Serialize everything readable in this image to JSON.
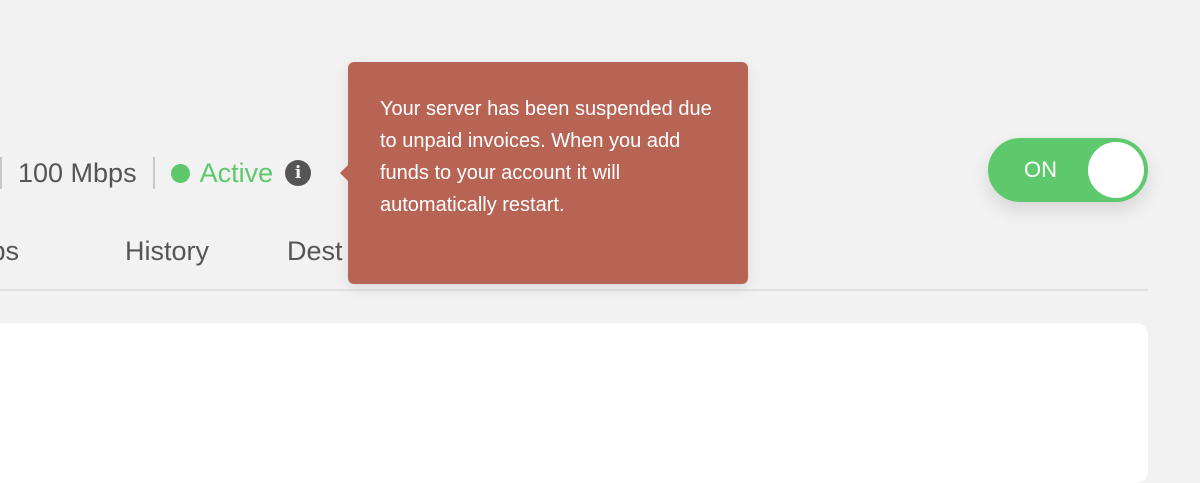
{
  "colors": {
    "background": "#f2f2f2",
    "text": "#555555",
    "active_green": "#5ec86c",
    "tooltip_bg": "#b86454",
    "toggle_bg": "#5ec86c",
    "panel_bg": "#ffffff"
  },
  "server_status": {
    "bandwidth": "100 Mbps",
    "status_label": "Active",
    "info_icon": "info-circle-icon"
  },
  "tabs": [
    {
      "label": "kups"
    },
    {
      "label": "History"
    },
    {
      "label": "Dest"
    }
  ],
  "tooltip": {
    "text": "Your server has been suspended due to unpaid invoices. When you add funds to your account it will automatically restart."
  },
  "power_toggle": {
    "label": "ON",
    "state": "on"
  }
}
